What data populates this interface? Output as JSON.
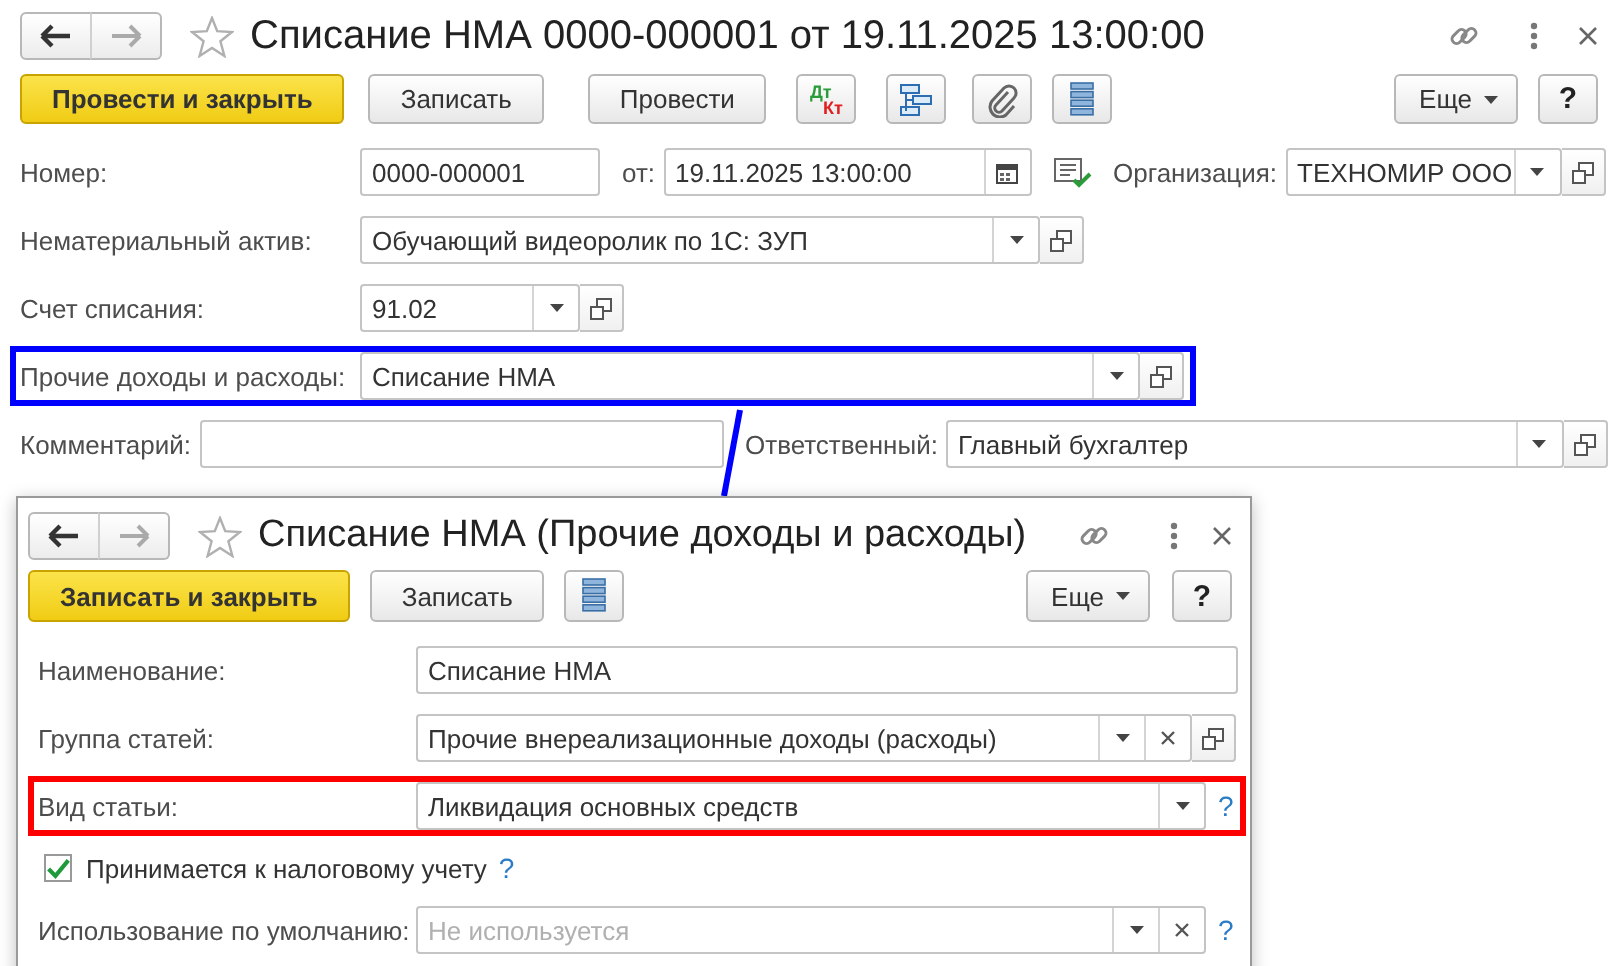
{
  "window": {
    "title": "Списание НМА 0000-000001 от 19.11.2025 13:00:00"
  },
  "toolbar": [
    {
      "kind": "primary",
      "label": "Провести и закрыть"
    },
    {
      "kind": "button",
      "label": "Записать"
    },
    {
      "kind": "button",
      "label": "Провести"
    },
    {
      "kind": "dtkt",
      "label": "Дт",
      "sublabel": "Кт"
    },
    {
      "kind": "structure"
    },
    {
      "kind": "attach"
    },
    {
      "kind": "list"
    },
    {
      "kind": "menu",
      "label": "Еще"
    },
    {
      "kind": "help",
      "label": "?"
    }
  ],
  "rows": [
    {
      "items": [
        {
          "kind": "field",
          "label": "Номер:",
          "value": "0000-000001"
        },
        {
          "kind": "field",
          "label": "от:",
          "value": "19.11.2025 13:00:00",
          "calendar": true
        },
        {
          "kind": "status-icon"
        },
        {
          "kind": "field",
          "label": "Организация:",
          "value": "ТЕХНОМИР ООО",
          "dropdown": true,
          "open": true
        }
      ]
    },
    {
      "items": [
        {
          "kind": "field",
          "label": "Нематериальный актив:",
          "value": "Обучающий видеоролик по 1С: ЗУП",
          "dropdown": true,
          "open": true
        }
      ]
    },
    {
      "items": [
        {
          "kind": "field",
          "label": "Счет списания:",
          "value": "91.02",
          "dropdown": true,
          "open": true
        }
      ]
    },
    {
      "color": "#0000ff",
      "items": [
        {
          "kind": "field",
          "label": "Прочие доходы и расходы:",
          "value": "Списание НМА",
          "dropdown": true,
          "open": true
        }
      ]
    },
    {
      "items": [
        {
          "kind": "field",
          "label": "Комментарий:"
        },
        {
          "kind": "field",
          "label": "Ответственный:",
          "value": "Главный бухгалтер",
          "dropdown": true,
          "open": true
        }
      ]
    }
  ],
  "dialog": {
    "title": "Списание НМА (Прочие доходы и расходы)",
    "toolbar": [
      {
        "kind": "primary",
        "label": "Записать и закрыть"
      },
      {
        "kind": "button",
        "label": "Записать"
      },
      {
        "kind": "list"
      },
      {
        "kind": "menu",
        "label": "Еще"
      },
      {
        "kind": "help",
        "label": "?"
      }
    ],
    "rows": [
      {
        "items": [
          {
            "kind": "field",
            "label": "Наименование:",
            "value": "Списание НМА"
          }
        ]
      },
      {
        "items": [
          {
            "kind": "field",
            "label": "Группа статей:",
            "value": "Прочие внереализационные доходы (расходы)",
            "dropdown": true,
            "clear": true,
            "open": true
          }
        ]
      },
      {
        "color": "#ff0000",
        "items": [
          {
            "kind": "field",
            "label": "Вид статьи:",
            "value": "Ликвидация основных средств",
            "dropdown": true,
            "help": "?"
          }
        ]
      },
      {
        "kind": "checkbox",
        "label": "Принимается к налоговому учету",
        "checked": true,
        "help": "?"
      },
      {
        "items": [
          {
            "kind": "field",
            "label": "Использование по умолчанию:",
            "placeholder": "Не используется",
            "dropdown": true,
            "clear": true,
            "help": "?"
          }
        ]
      }
    ]
  }
}
